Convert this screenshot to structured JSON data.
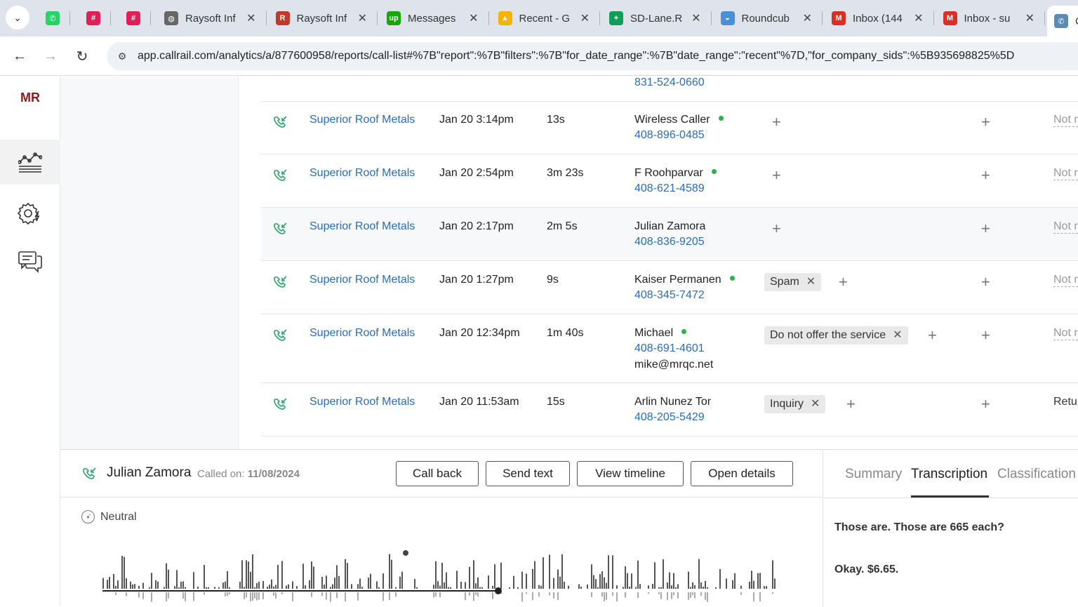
{
  "browser": {
    "tabs": [
      {
        "title": "",
        "favicon": "whatsapp-icon",
        "color": "#25d366",
        "glyph": "✆"
      },
      {
        "title": "",
        "favicon": "slack-icon",
        "color": "#e01e5a",
        "glyph": "#"
      },
      {
        "title": "",
        "favicon": "slack-icon",
        "color": "#e01e5a",
        "glyph": "#"
      },
      {
        "title": "Raysoft Inf",
        "favicon": "globe-icon",
        "color": "#666666",
        "glyph": "◍"
      },
      {
        "title": "Raysoft Inf",
        "favicon": "raysoft-icon",
        "color": "#c0392b",
        "glyph": "R"
      },
      {
        "title": "Messages",
        "favicon": "upwork-icon",
        "color": "#14a800",
        "glyph": "up"
      },
      {
        "title": "Recent - G",
        "favicon": "google-drive-icon",
        "color": "#f4b400",
        "glyph": "▲"
      },
      {
        "title": "SD-Lane.R",
        "favicon": "google-sheets-icon",
        "color": "#0f9d58",
        "glyph": "+"
      },
      {
        "title": "Roundcub",
        "favicon": "roundcube-icon",
        "color": "#4a90d9",
        "glyph": "◒"
      },
      {
        "title": "Inbox (144",
        "favicon": "gmail-icon",
        "color": "#d93025",
        "glyph": "M"
      },
      {
        "title": "Inbox - su",
        "favicon": "gmail-icon",
        "color": "#d93025",
        "glyph": "M"
      },
      {
        "title": "C",
        "favicon": "callrail-icon",
        "color": "#5b8ab5",
        "glyph": "✆"
      }
    ],
    "url": "app.callrail.com/analytics/a/877600958/reports/call-list#%7B\"report\":%7B\"filters\":%7B\"for_date_range\":%7B\"date_range\":\"recent\"%7D,\"for_company_sids\":%5B935698825%5D"
  },
  "sidebar": {
    "logo": "MR",
    "items": [
      "analytics-icon",
      "settings-automation-icon",
      "conversations-icon"
    ]
  },
  "calls": {
    "top_partial_phone": "831-524-0660",
    "rows": [
      {
        "company": "Superior Roof Metals",
        "date": "Jan 20 3:14pm",
        "duration": "13s",
        "caller": "Wireless Caller",
        "online": true,
        "phone": "408-896-0485",
        "email": "",
        "tag": "",
        "status": "Not r"
      },
      {
        "company": "Superior Roof Metals",
        "date": "Jan 20 2:54pm",
        "duration": "3m 23s",
        "caller": "F Roohparvar",
        "online": true,
        "phone": "408-621-4589",
        "email": "",
        "tag": "",
        "status": "Not r"
      },
      {
        "company": "Superior Roof Metals",
        "date": "Jan 20 2:17pm",
        "duration": "2m 5s",
        "caller": "Julian Zamora",
        "online": false,
        "phone": "408-836-9205",
        "email": "",
        "tag": "",
        "status": "Not r"
      },
      {
        "company": "Superior Roof Metals",
        "date": "Jan 20 1:27pm",
        "duration": "9s",
        "caller": "Kaiser Permanen",
        "online": true,
        "phone": "408-345-7472",
        "email": "",
        "tag": "Spam",
        "status": "Not r"
      },
      {
        "company": "Superior Roof Metals",
        "date": "Jan 20 12:34pm",
        "duration": "1m 40s",
        "caller": "Michael",
        "online": true,
        "phone": "408-691-4601",
        "email": "mike@mrqc.net",
        "tag": "Do not offer the service",
        "status": "Not r"
      },
      {
        "company": "Superior Roof Metals",
        "date": "Jan 20 11:53am",
        "duration": "15s",
        "caller": "Arlin Nunez Tor",
        "online": false,
        "phone": "408-205-5429",
        "email": "",
        "tag": "Inquiry",
        "status": "Retu"
      }
    ]
  },
  "detail": {
    "name": "Julian Zamora",
    "called_label": "Called on:",
    "called_date": "11/08/2024",
    "buttons": {
      "call_back": "Call back",
      "send_text": "Send text",
      "view_timeline": "View timeline",
      "open_details": "Open details"
    },
    "sentiment": "Neutral",
    "tabs": {
      "summary": "Summary",
      "transcription": "Transcription",
      "classification": "Classification"
    },
    "active_tab": "Transcription",
    "transcript": [
      "Those are. Those are 665 each?",
      "Okay. $6.65."
    ],
    "playback_progress": 0.585
  },
  "colors": {
    "link": "#2a6db5",
    "online_dot": "#2fb04a",
    "brand": "#8b1a1a"
  }
}
